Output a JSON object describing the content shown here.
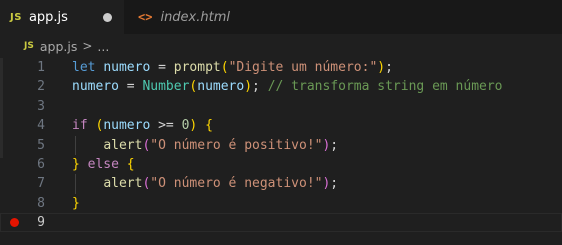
{
  "tabs": [
    {
      "badge": "JS",
      "label": "app.js",
      "active": true,
      "modified": true
    },
    {
      "badge": "<>",
      "label": "index.html",
      "active": false
    }
  ],
  "breadcrumb": {
    "badge": "JS",
    "file": "app.js",
    "separator": ">",
    "more": "..."
  },
  "lines": [
    {
      "number": "1",
      "tokens": [
        {
          "t": "let",
          "c": "kw"
        },
        {
          "t": " ",
          "c": "op"
        },
        {
          "t": "numero",
          "c": "var"
        },
        {
          "t": " = ",
          "c": "op"
        },
        {
          "t": "prompt",
          "c": "fn"
        },
        {
          "t": "(",
          "c": "p1"
        },
        {
          "t": "\"Digite um número:\"",
          "c": "str"
        },
        {
          "t": ")",
          "c": "p1"
        },
        {
          "t": ";",
          "c": "op"
        }
      ]
    },
    {
      "number": "2",
      "tokens": [
        {
          "t": "numero",
          "c": "var"
        },
        {
          "t": " = ",
          "c": "op"
        },
        {
          "t": "Number",
          "c": "cls"
        },
        {
          "t": "(",
          "c": "p1"
        },
        {
          "t": "numero",
          "c": "var"
        },
        {
          "t": ")",
          "c": "p1"
        },
        {
          "t": "; ",
          "c": "op"
        },
        {
          "t": "// transforma string em número",
          "c": "cmt"
        }
      ]
    },
    {
      "number": "3",
      "tokens": []
    },
    {
      "number": "4",
      "tokens": [
        {
          "t": "if",
          "c": "ctrl"
        },
        {
          "t": " ",
          "c": "op"
        },
        {
          "t": "(",
          "c": "p1"
        },
        {
          "t": "numero",
          "c": "var"
        },
        {
          "t": " >= ",
          "c": "op"
        },
        {
          "t": "0",
          "c": "num"
        },
        {
          "t": ")",
          "c": "p1"
        },
        {
          "t": " ",
          "c": "op"
        },
        {
          "t": "{",
          "c": "p1"
        }
      ]
    },
    {
      "number": "5",
      "tokens": [
        {
          "t": "    ",
          "c": "op"
        },
        {
          "t": "alert",
          "c": "fn"
        },
        {
          "t": "(",
          "c": "p2"
        },
        {
          "t": "\"O número é positivo!\"",
          "c": "str"
        },
        {
          "t": ")",
          "c": "p2"
        },
        {
          "t": ";",
          "c": "op"
        }
      ]
    },
    {
      "number": "6",
      "tokens": [
        {
          "t": "}",
          "c": "p1"
        },
        {
          "t": " ",
          "c": "op"
        },
        {
          "t": "else",
          "c": "ctrl"
        },
        {
          "t": " ",
          "c": "op"
        },
        {
          "t": "{",
          "c": "p1"
        }
      ]
    },
    {
      "number": "7",
      "tokens": [
        {
          "t": "    ",
          "c": "op"
        },
        {
          "t": "alert",
          "c": "fn"
        },
        {
          "t": "(",
          "c": "p2"
        },
        {
          "t": "\"O número é negativo!\"",
          "c": "str"
        },
        {
          "t": ")",
          "c": "p2"
        },
        {
          "t": ";",
          "c": "op"
        }
      ]
    },
    {
      "number": "8",
      "tokens": [
        {
          "t": "}",
          "c": "p1"
        }
      ]
    },
    {
      "number": "9",
      "tokens": [],
      "current": true,
      "breakpoint": true
    }
  ],
  "colors": {
    "editor_bg": "#1f1f1f",
    "tabbar_bg": "#181818",
    "breakpoint": "#e51400",
    "js_badge": "#cbcb41",
    "html_badge": "#e37933"
  }
}
